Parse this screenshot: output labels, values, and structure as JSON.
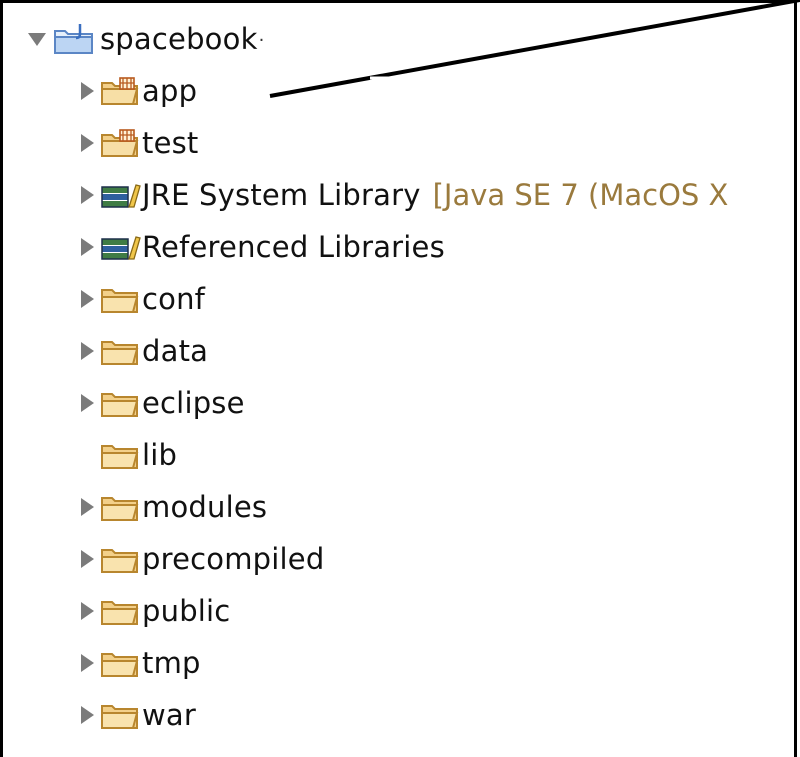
{
  "project": {
    "name": "spacebook",
    "name_suffix": "·",
    "icon": "java-project-folder-icon",
    "expanded": true
  },
  "items": [
    {
      "label": "app",
      "icon": "source-package-folder-icon",
      "has_toggle": true
    },
    {
      "label": "test",
      "icon": "source-package-folder-icon",
      "has_toggle": true
    },
    {
      "label": "JRE System Library",
      "decoration": "[Java SE 7 (MacOS X",
      "icon": "library-books-icon",
      "has_toggle": true
    },
    {
      "label": "Referenced Libraries",
      "icon": "library-books-icon",
      "has_toggle": true
    },
    {
      "label": "conf",
      "icon": "folder-icon",
      "has_toggle": true
    },
    {
      "label": "data",
      "icon": "folder-icon",
      "has_toggle": true
    },
    {
      "label": "eclipse",
      "icon": "folder-icon",
      "has_toggle": true
    },
    {
      "label": "lib",
      "icon": "folder-icon",
      "has_toggle": false
    },
    {
      "label": "modules",
      "icon": "folder-icon",
      "has_toggle": true
    },
    {
      "label": "precompiled",
      "icon": "folder-icon",
      "has_toggle": true
    },
    {
      "label": "public",
      "icon": "folder-icon",
      "has_toggle": true
    },
    {
      "label": "tmp",
      "icon": "folder-icon",
      "has_toggle": true
    },
    {
      "label": "war",
      "icon": "folder-icon",
      "has_toggle": true
    }
  ],
  "colors": {
    "folder_fill": "#f3d08a",
    "folder_stroke": "#b8862e",
    "decoration_text": "#9a7a3d",
    "toggle": "#7b7b7b"
  }
}
